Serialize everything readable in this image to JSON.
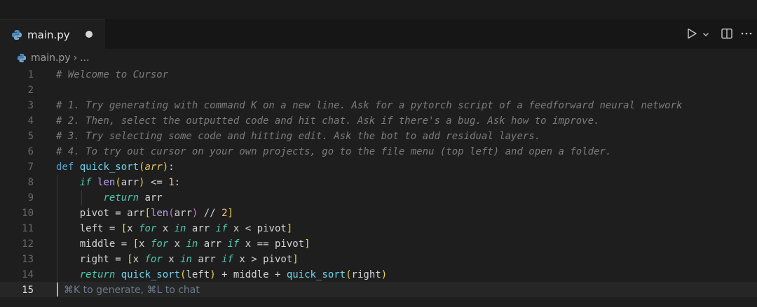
{
  "window": {
    "title": ""
  },
  "tab": {
    "label": "main.py",
    "modified": true
  },
  "breadcrumb": {
    "file": "main.py",
    "sep": "›",
    "rest": "..."
  },
  "actions": {
    "run": "▷",
    "run_menu": "⌄",
    "split": "◫",
    "more": "⋯"
  },
  "editor": {
    "current_line": 15,
    "hint": "⌘K to generate, ⌘L to chat",
    "lines": [
      "# Welcome to Cursor",
      "",
      "# 1. Try generating with command K on a new line. Ask for a pytorch script of a feedforward neural network",
      "# 2. Then, select the outputted code and hit chat. Ask if there's a bug. Ask how to improve.",
      "# 3. Try selecting some code and hitting edit. Ask the bot to add residual layers.",
      "# 4. To try out cursor on your own projects, go to the file menu (top left) and open a folder.",
      "def quick_sort(arr):",
      "    if len(arr) <= 1:",
      "        return arr",
      "    pivot = arr[len(arr) // 2]",
      "    left = [x for x in arr if x < pivot]",
      "    middle = [x for x in arr if x == pivot]",
      "    right = [x for x in arr if x > pivot]",
      "    return quick_sort(left) + middle + quick_sort(right)",
      ""
    ],
    "line_numbers": [
      "1",
      "2",
      "3",
      "4",
      "5",
      "6",
      "7",
      "8",
      "9",
      "10",
      "11",
      "12",
      "13",
      "14",
      "15"
    ]
  },
  "colors": {
    "background": "#1e1e1e",
    "comment": "#7c7c7c",
    "keyword": "#5ba0d0",
    "function": "#6fd3ea",
    "param": "#e9c46a",
    "number": "#f7c08a"
  }
}
